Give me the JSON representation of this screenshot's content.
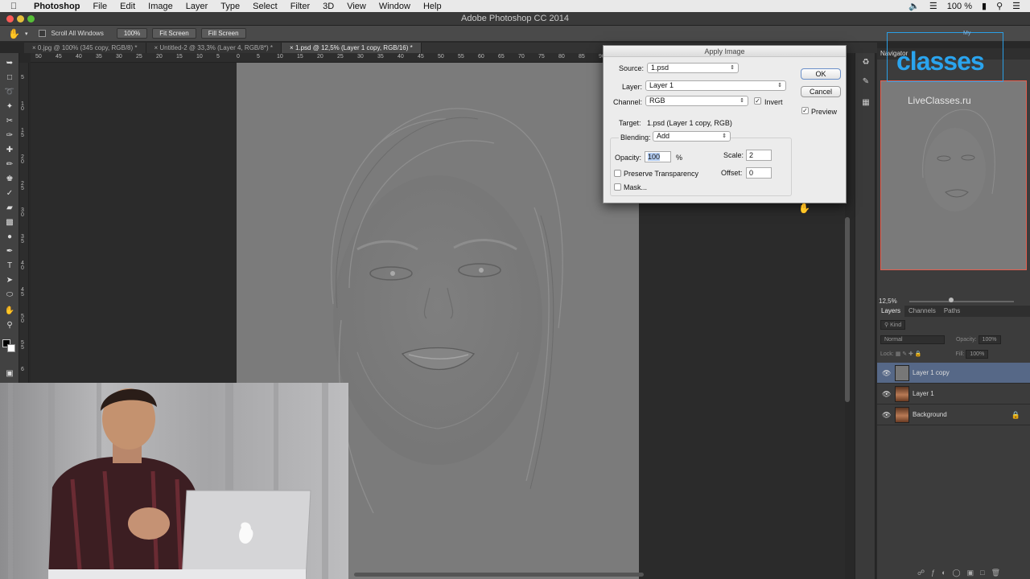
{
  "menubar": {
    "app": "Photoshop",
    "items": [
      "File",
      "Edit",
      "Image",
      "Layer",
      "Type",
      "Select",
      "Filter",
      "3D",
      "View",
      "Window",
      "Help"
    ],
    "battery": "100 %"
  },
  "window": {
    "title": "Adobe Photoshop CC 2014"
  },
  "options": {
    "scroll_all": "Scroll All Windows",
    "zoom_100": "100%",
    "fit_screen": "Fit Screen",
    "fill_screen": "Fill Screen"
  },
  "tabs": [
    {
      "label": "0.jpg @ 100% (345 copy, RGB/8) *"
    },
    {
      "label": "Untitled-2 @ 33,3% (Layer 4, RGB/8*) *"
    },
    {
      "label": "1.psd @ 12,5% (Layer 1 copy, RGB/16) *"
    }
  ],
  "ruler": {
    "h": [
      "50",
      "45",
      "40",
      "35",
      "30",
      "25",
      "20",
      "15",
      "10",
      "5",
      "0",
      "5",
      "10",
      "15",
      "20",
      "25",
      "30",
      "35",
      "40",
      "45",
      "50",
      "55",
      "60",
      "65",
      "70",
      "75",
      "80",
      "85",
      "90"
    ],
    "v": [
      "5",
      "1 0",
      "1 5",
      "2 0",
      "2 5",
      "3 0",
      "3 5",
      "4 0",
      "4 5",
      "5 0",
      "5 5",
      "6"
    ]
  },
  "dialog": {
    "title": "Apply Image",
    "source_label": "Source:",
    "source_value": "1.psd",
    "layer_label": "Layer:",
    "layer_value": "Layer 1",
    "channel_label": "Channel:",
    "channel_value": "RGB",
    "invert_label": "Invert",
    "target_label": "Target:",
    "target_value": "1.psd (Layer 1 copy, RGB)",
    "blending_label": "Blending:",
    "blending_value": "Add",
    "opacity_label": "Opacity:",
    "opacity_value": "100",
    "opacity_unit": "%",
    "scale_label": "Scale:",
    "scale_value": "2",
    "offset_label": "Offset:",
    "offset_value": "0",
    "preserve_label": "Preserve Transparency",
    "mask_label": "Mask...",
    "ok_label": "OK",
    "cancel_label": "Cancel",
    "preview_label": "Preview"
  },
  "navigator": {
    "title": "Navigator",
    "zoom": "12,5%"
  },
  "watermark": {
    "brand": "classes",
    "site": "LiveClasses.ru",
    "tag": "My"
  },
  "layers_panel": {
    "tabs": [
      "Layers",
      "Channels",
      "Paths"
    ],
    "filter": "Kind",
    "blend_mode": "Normal",
    "opacity_label": "Opacity:",
    "opacity_value": "100%",
    "lock_label": "Lock:",
    "fill_label": "Fill:",
    "fill_value": "100%",
    "layers": [
      {
        "name": "Layer 1 copy"
      },
      {
        "name": "Layer 1"
      },
      {
        "name": "Background"
      }
    ]
  },
  "colors": {
    "accent": "#566887",
    "watermark": "#2aa4ee",
    "nav_frame": "#e46050"
  }
}
